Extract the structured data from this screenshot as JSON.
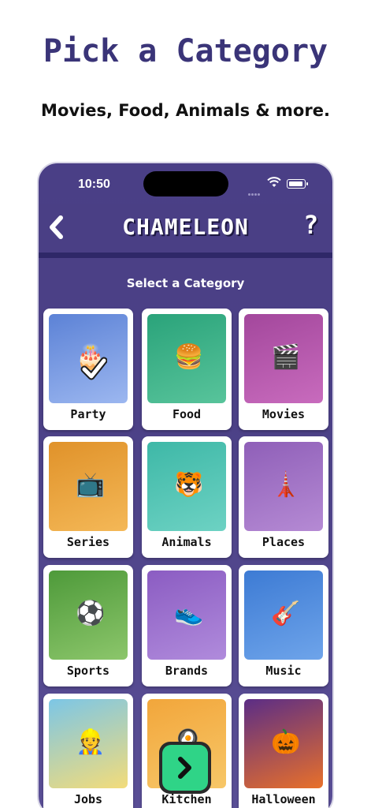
{
  "promo": {
    "title": "Pick a Category",
    "subtitle": "Movies, Food, Animals & more."
  },
  "status_bar": {
    "time": "10:50"
  },
  "header": {
    "back_icon": "chevron-left-icon",
    "title": "CHAMELEON",
    "help_label": "?"
  },
  "section_label": "Select a Category",
  "categories": [
    {
      "label": "Party",
      "selected": true,
      "bg": [
        "#5c82d6",
        "#9cb7f0"
      ]
    },
    {
      "label": "Food",
      "selected": false,
      "bg": [
        "#2aa37a",
        "#58c49b"
      ]
    },
    {
      "label": "Movies",
      "selected": false,
      "bg": [
        "#a3479c",
        "#c86bbd"
      ]
    },
    {
      "label": "Series",
      "selected": false,
      "bg": [
        "#e0922a",
        "#f4b857"
      ]
    },
    {
      "label": "Animals",
      "selected": false,
      "bg": [
        "#3eb8a7",
        "#6dd2c3"
      ]
    },
    {
      "label": "Places",
      "selected": false,
      "bg": [
        "#8f5fb8",
        "#b58ad4"
      ]
    },
    {
      "label": "Sports",
      "selected": false,
      "bg": [
        "#4e9a3a",
        "#8cc66b"
      ]
    },
    {
      "label": "Brands",
      "selected": false,
      "bg": [
        "#8b5cc2",
        "#b08bdc"
      ]
    },
    {
      "label": "Music",
      "selected": false,
      "bg": [
        "#3d7bd4",
        "#6ea4ea"
      ]
    },
    {
      "label": "Jobs",
      "selected": false,
      "bg": [
        "#7cc6e6",
        "#f3dc7a"
      ]
    },
    {
      "label": "Kitchen",
      "selected": false,
      "bg": [
        "#f2a63b",
        "#f7c768"
      ]
    },
    {
      "label": "Halloween",
      "selected": false,
      "bg": [
        "#5b2d86",
        "#e8702a"
      ]
    }
  ],
  "next_button_icon": "chevron-right-icon",
  "colors": {
    "accent": "#3a3478",
    "header_bg": "#4a3f85",
    "next_green": "#2fd487"
  }
}
